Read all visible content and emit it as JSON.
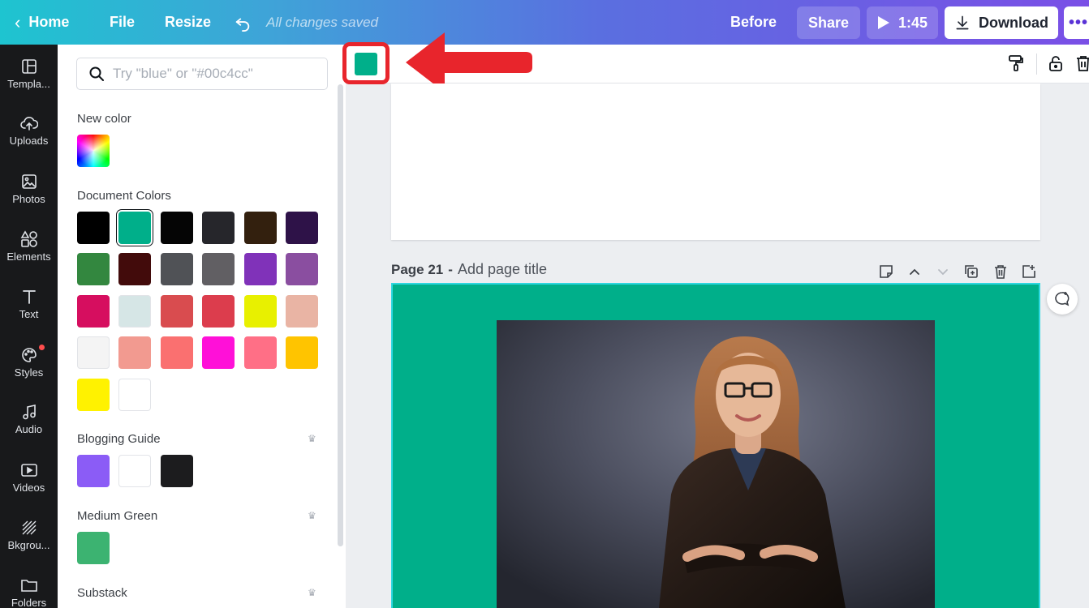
{
  "topbar": {
    "home_label": "Home",
    "file_label": "File",
    "resize_label": "Resize",
    "saved_status": "All changes saved",
    "before_label": "Before",
    "share_label": "Share",
    "play_time": "1:45",
    "download_label": "Download",
    "more_label": "•••"
  },
  "rail": {
    "items": [
      {
        "label": "Templa...",
        "icon": "template-icon"
      },
      {
        "label": "Uploads",
        "icon": "upload-icon"
      },
      {
        "label": "Photos",
        "icon": "photo-icon"
      },
      {
        "label": "Elements",
        "icon": "elements-icon"
      },
      {
        "label": "Text",
        "icon": "text-icon"
      },
      {
        "label": "Styles",
        "icon": "palette-icon"
      },
      {
        "label": "Audio",
        "icon": "music-icon"
      },
      {
        "label": "Videos",
        "icon": "video-icon"
      },
      {
        "label": "Bkgrou...",
        "icon": "background-icon"
      },
      {
        "label": "Folders",
        "icon": "folder-icon"
      }
    ]
  },
  "panel": {
    "search_placeholder": "Try \"blue\" or \"#00c4cc\"",
    "new_color_title": "New color",
    "document_colors_title": "Document Colors",
    "document_colors": [
      "#000000",
      "#00af8a",
      "#050505",
      "#26262b",
      "#33200e",
      "#2e1248",
      "#33873f",
      "#420b0b",
      "#505256",
      "#615f63",
      "#8032b9",
      "#8a4ea0",
      "#d60e5f",
      "#d6e6e6",
      "#d94c4f",
      "#dc3d4d",
      "#e8f000",
      "#e9b4a4",
      "#f4f4f4",
      "#f29a90",
      "#fa7070",
      "#ff10d8",
      "#ff6f86",
      "#ffc400",
      "#fff200",
      "#ffffff"
    ],
    "selected_color": "#00af8a",
    "blogging_title": "Blogging Guide",
    "blogging_colors": [
      "#8b5cf6",
      "#ffffff",
      "#1c1c1e"
    ],
    "medium_green_title": "Medium Green",
    "medium_green_colors": [
      "#3cb371"
    ],
    "substack_title": "Substack"
  },
  "editor": {
    "current_fill": "#00af8a",
    "page_number": "Page 21",
    "page_separator": "-",
    "page_title_placeholder": "Add page title",
    "page_background": "#00af8a"
  },
  "colors": {
    "highlight": "#e8252c",
    "rail_bg": "#18191b",
    "accent": "#7a4fe6"
  }
}
